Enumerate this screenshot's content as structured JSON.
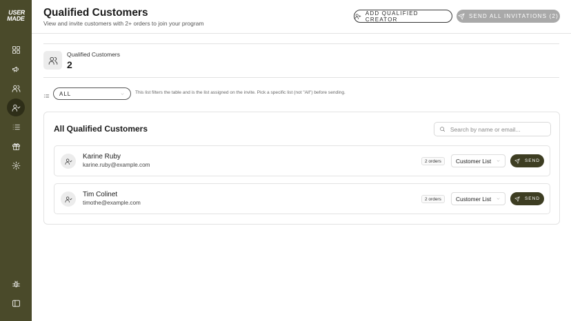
{
  "sidebar": {
    "logo_line1": "USER",
    "logo_line2": "MADE",
    "icons": [
      "grid-icon",
      "megaphone-icon",
      "users-icon",
      "user-check-icon",
      "list-icon",
      "gift-icon",
      "settings-icon",
      "bug-icon",
      "sidebar-toggle-icon"
    ],
    "active_icon": "user-check-icon",
    "background": "#4a4a2a"
  },
  "header": {
    "title": "Qualified Customers",
    "subtitle": "View and invite customers with 2+ orders to join your program",
    "add_button_label": "ADD QUALIFIED CREATOR",
    "send_all_button_label": "SEND ALL INVITATIONS (2)"
  },
  "stat": {
    "label": "Qualified Customers",
    "value": "2"
  },
  "filter": {
    "selected": "ALL",
    "help_text": "This list filters the table and is the list assigned on the invite. Pick a specific list (not \"All\") before sending."
  },
  "table": {
    "title": "All Qualified Customers",
    "search_placeholder": "Search by name or email...",
    "rows": [
      {
        "name": "Karine Ruby",
        "email": "karine.ruby@example.com",
        "orders": "2 orders",
        "list": "Customer List",
        "send_label": "SEND"
      },
      {
        "name": "Tim Colinet",
        "email": "timothe@example.com",
        "orders": "2 orders",
        "list": "Customer List",
        "send_label": "SEND"
      }
    ]
  },
  "colors": {
    "accent_dark": "#3d3d22",
    "disabled_button": "#a9a9a9"
  }
}
